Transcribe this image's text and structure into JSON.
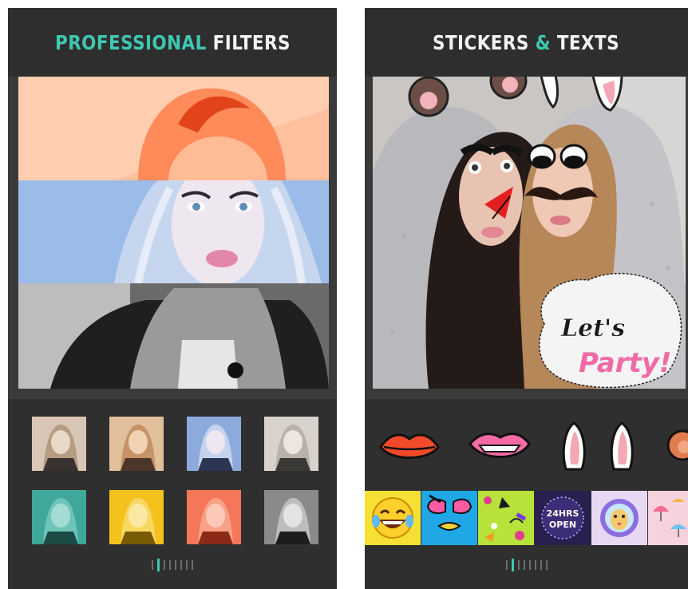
{
  "left_panel": {
    "title_accent": "PROFESSIONAL",
    "title_rest": " FILTERS",
    "filter_count": 8,
    "pager": {
      "count": 8,
      "active_index": 1
    }
  },
  "right_panel": {
    "title_part1": "STICKERS",
    "title_amp": " & ",
    "title_part2": "TEXTS",
    "lets_party": {
      "line1": "Let's",
      "line2": "Party!"
    },
    "clock_sticker": {
      "line1": "24HRS",
      "line2": "OPEN"
    },
    "pager": {
      "count": 8,
      "active_index": 1
    }
  },
  "colors": {
    "accent": "#3fc7b1",
    "panel_bg": "#3a3a3a",
    "header_bg": "#2e2e2e",
    "filter_peach": "#ffb08a",
    "filter_blue": "#8fb0e6",
    "party_pink": "#f06aa5"
  }
}
